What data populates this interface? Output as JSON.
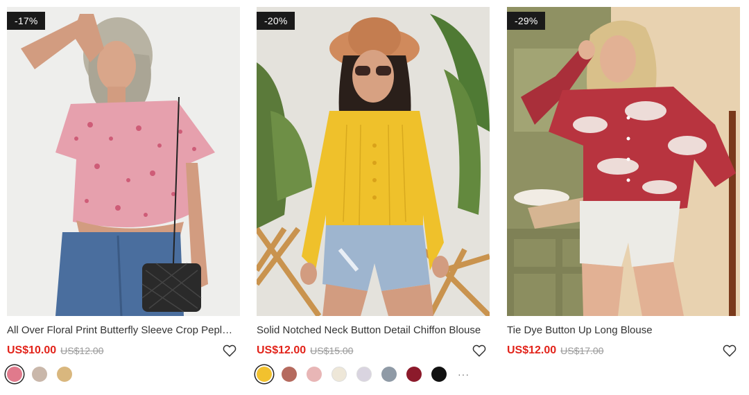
{
  "products": [
    {
      "badge": "-17%",
      "title": "All Over Floral Print Butterfly Sleeve Crop Peplum Blouse",
      "price": "US$10.00",
      "old_price": "US$12.00",
      "wishlist_icon": "heart-outline-icon",
      "swatches": [
        {
          "color": "#e07a8c",
          "selected": true
        },
        {
          "color": "#c9b7aa",
          "selected": false
        },
        {
          "color": "#d9b77e",
          "selected": false
        }
      ],
      "more": ""
    },
    {
      "badge": "-20%",
      "title": "Solid Notched Neck Button Detail Chiffon Blouse",
      "price": "US$12.00",
      "old_price": "US$15.00",
      "wishlist_icon": "heart-outline-icon",
      "swatches": [
        {
          "color": "#f2c12e",
          "selected": true
        },
        {
          "color": "#b56a5e",
          "selected": false
        },
        {
          "color": "#e8b6b6",
          "selected": false
        },
        {
          "color": "#eee7d8",
          "selected": false
        },
        {
          "color": "#d9d4e0",
          "selected": false
        },
        {
          "color": "#8f9aa6",
          "selected": false
        },
        {
          "color": "#8c1a2b",
          "selected": false
        },
        {
          "color": "#111111",
          "selected": false
        }
      ],
      "more": "···"
    },
    {
      "badge": "-29%",
      "title": "Tie Dye Button Up Long Blouse",
      "price": "US$12.00",
      "old_price": "US$17.00",
      "wishlist_icon": "heart-outline-icon",
      "swatches": [],
      "more": ""
    }
  ],
  "colors": {
    "price": "#e2231a",
    "badge_bg": "#1a1a1a",
    "old_price": "#999999"
  }
}
